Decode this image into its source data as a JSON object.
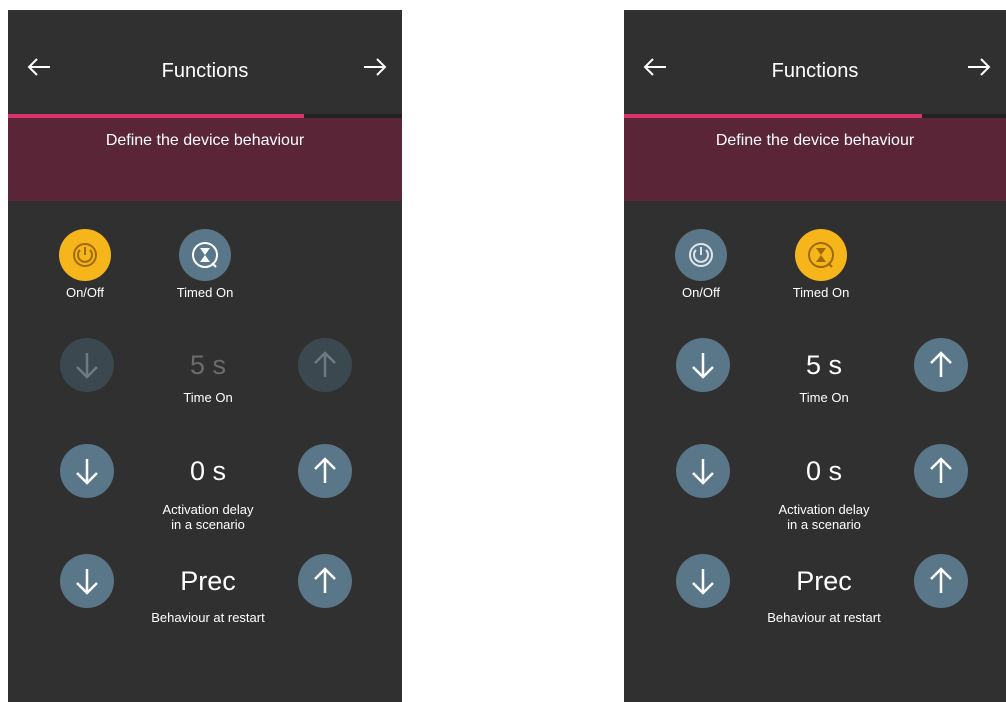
{
  "left_screen": {
    "title": "Functions",
    "progress_fraction": 0.75,
    "banner_text": "Define the device behaviour",
    "modes": [
      {
        "label": "On/Off",
        "icon": "power-icon",
        "selected": true
      },
      {
        "label": "Timed On",
        "icon": "hourglass-icon",
        "selected": false
      }
    ],
    "settings": [
      {
        "value": "5 s",
        "caption": "Time On",
        "enabled": false
      },
      {
        "value": "0 s",
        "caption": "Activation delay\nin a scenario",
        "enabled": true
      },
      {
        "value": "Prec",
        "caption": "Behaviour at restart",
        "enabled": true
      }
    ]
  },
  "right_screen": {
    "title": "Functions",
    "progress_fraction": 0.78,
    "banner_text": "Define the device behaviour",
    "modes": [
      {
        "label": "On/Off",
        "icon": "power-icon",
        "selected": false
      },
      {
        "label": "Timed On",
        "icon": "hourglass-icon",
        "selected": true
      }
    ],
    "settings": [
      {
        "value": "5 s",
        "caption": "Time On",
        "enabled": true
      },
      {
        "value": "0 s",
        "caption": "Activation delay\nin a scenario",
        "enabled": true
      },
      {
        "value": "Prec",
        "caption": "Behaviour at restart",
        "enabled": true
      }
    ]
  },
  "colors": {
    "background": "#303030",
    "accent": "#d8336b",
    "banner": "#5b2538",
    "selected_mode": "#f5b51b",
    "button": "#5a7689",
    "button_disabled": "#3c4850"
  },
  "icons": {
    "back": "arrow-left-icon",
    "forward": "arrow-right-icon",
    "decrease": "arrow-down-icon",
    "increase": "arrow-up-icon"
  }
}
